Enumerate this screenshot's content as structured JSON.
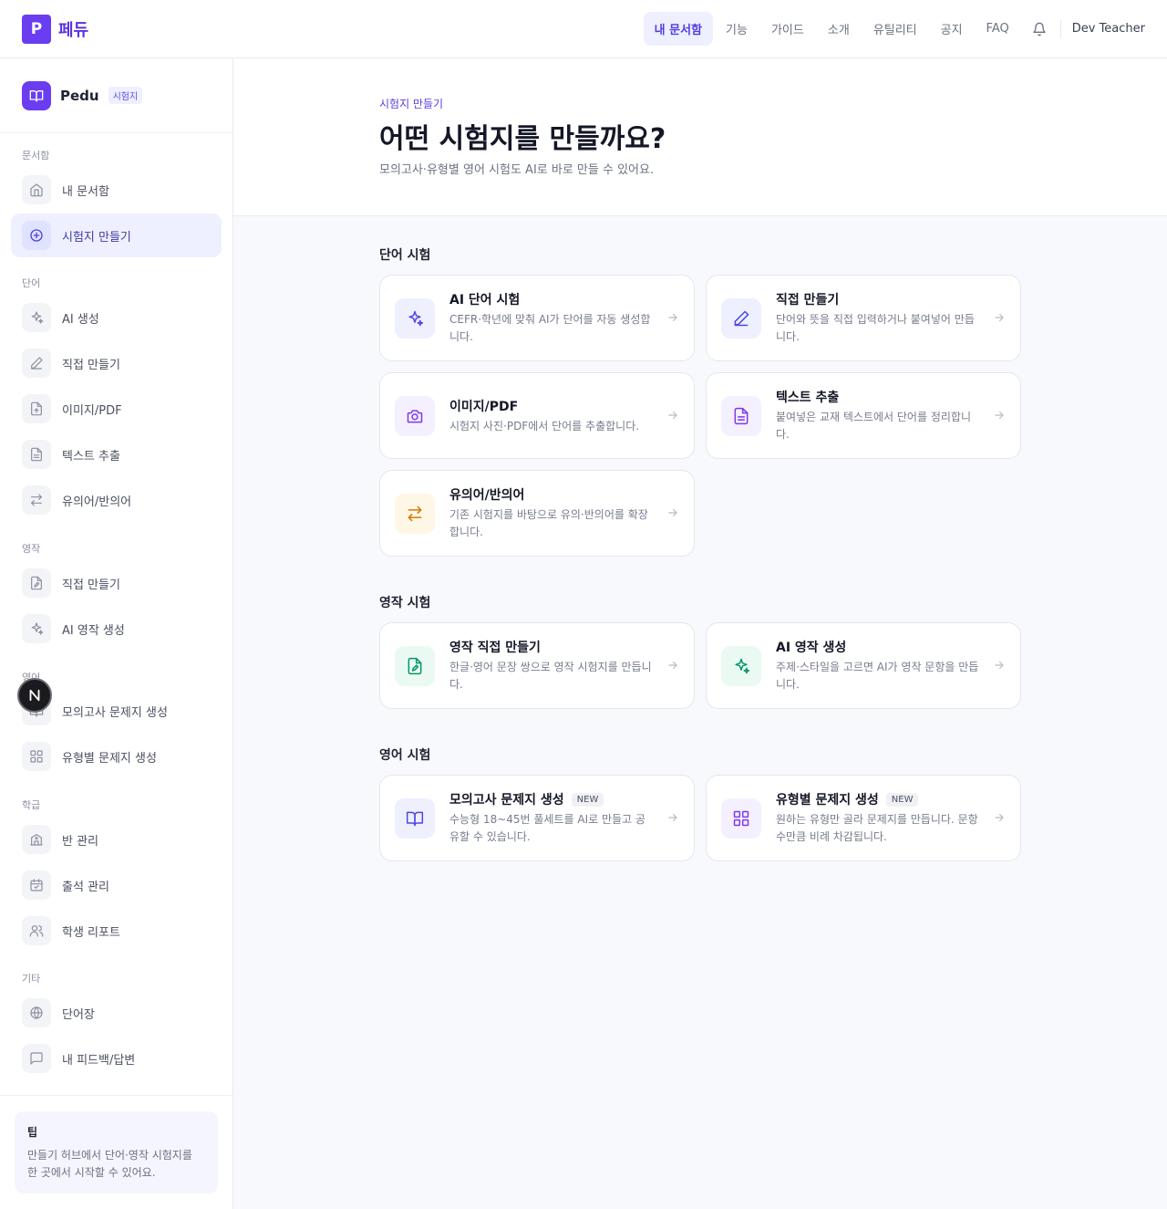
{
  "topnav": {
    "logo_letter": "P",
    "brand": "페듀",
    "links": [
      "내 문서함",
      "기능",
      "가이드",
      "소개",
      "유틸리티",
      "공지",
      "FAQ"
    ],
    "user": "Dev Teacher"
  },
  "sidebar": {
    "brand": "Pedu",
    "brand_tag": "시험지",
    "sections": {
      "docs": "문서함",
      "word": "단어",
      "writing": "영작",
      "english": "영어",
      "class": "학급",
      "etc": "기타"
    },
    "items": [
      {
        "label": "내 문서함",
        "icon": "home-icon"
      },
      {
        "label": "시험지 만들기",
        "icon": "plus-circle-icon"
      },
      {
        "label": "AI 생성",
        "icon": "sparkles-icon"
      },
      {
        "label": "직접 만들기",
        "icon": "pencil-icon"
      },
      {
        "label": "이미지/PDF",
        "icon": "file-upload-icon"
      },
      {
        "label": "텍스트 추출",
        "icon": "file-text-icon"
      },
      {
        "label": "유의어/반의어",
        "icon": "swap-icon"
      },
      {
        "label": "직접 만들기",
        "icon": "file-edit-icon"
      },
      {
        "label": "AI 영작 생성",
        "icon": "sparkles-icon"
      },
      {
        "label": "모의고사 문제지 생성",
        "icon": "book-icon"
      },
      {
        "label": "유형별 문제지 생성",
        "icon": "grid-icon"
      },
      {
        "label": "반 관리",
        "icon": "school-icon"
      },
      {
        "label": "출석 관리",
        "icon": "calendar-check-icon"
      },
      {
        "label": "학생 리포트",
        "icon": "users-icon"
      },
      {
        "label": "단어장",
        "icon": "globe-icon"
      },
      {
        "label": "내 피드백/답변",
        "icon": "message-icon"
      }
    ],
    "tip": {
      "title": "팁",
      "body": "만들기 허브에서 단어·영작 시험지를 한 곳에서 시작할 수 있어요."
    }
  },
  "header": {
    "breadcrumb": "시험지 만들기",
    "title": "어떤 시험지를 만들까요?",
    "subtitle": "모의고사·유형별 영어 시험도 AI로 바로 만들 수 있어요."
  },
  "sections": {
    "word": {
      "title": "단어 시험",
      "cards": [
        {
          "title": "AI 단어 시험",
          "desc": "CEFR·학년에 맞춰 AI가 단어를 자동 생성합니다."
        },
        {
          "title": "직접 만들기",
          "desc": "단어와 뜻을 직접 입력하거나 붙여넣어 만듭니다."
        },
        {
          "title": "이미지/PDF",
          "desc": "시험지 사진·PDF에서 단어를 추출합니다."
        },
        {
          "title": "텍스트 추출",
          "desc": "붙여넣은 교재 텍스트에서 단어를 정리합니다."
        },
        {
          "title": "유의어/반의어",
          "desc": "기존 시험지를 바탕으로 유의·반의어를 확장합니다."
        }
      ]
    },
    "writing": {
      "title": "영작 시험",
      "cards": [
        {
          "title": "영작 직접 만들기",
          "desc": "한글·영어 문장 쌍으로 영작 시험지를 만듭니다."
        },
        {
          "title": "AI 영작 생성",
          "desc": "주제·스타일을 고르면 AI가 영작 문항을 만듭니다."
        }
      ]
    },
    "english": {
      "title": "영어 시험",
      "cards": [
        {
          "title": "모의고사 문제지 생성",
          "badge": "NEW",
          "desc": "수능형 18~45번 풀세트를 AI로 만들고 공유할 수 있습니다."
        },
        {
          "title": "유형별 문제지 생성",
          "badge": "NEW",
          "desc": "원하는 유형만 골라 문제지를 만듭니다. 문항 수만큼 비례 차감됩니다."
        }
      ]
    }
  },
  "colors": {
    "accent": "#6a3df0",
    "indigo_tile": "#eef0ff",
    "purple_tile": "#f5f0ff",
    "orange_tile": "#fff7e6",
    "green_tile": "#eafaf3"
  }
}
